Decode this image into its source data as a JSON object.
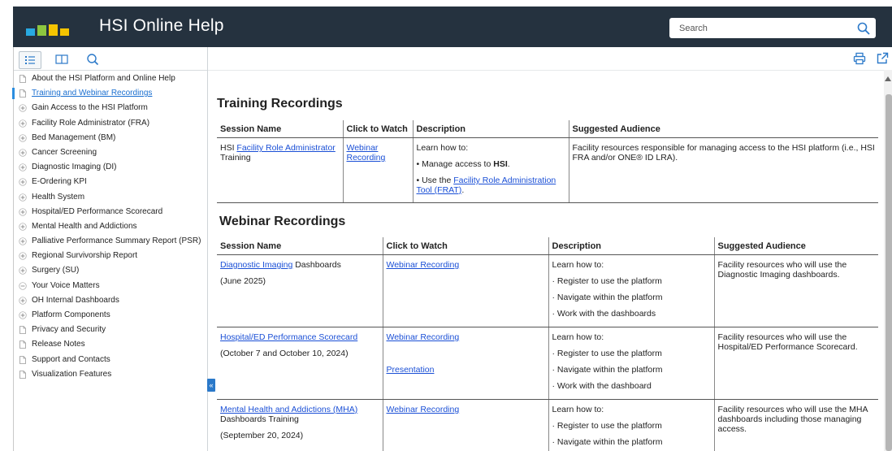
{
  "header": {
    "title": "HSI Online Help",
    "search_placeholder": "Search",
    "logo_colors": [
      "#28a9e1",
      "#8dc63f",
      "#f5c400",
      "#f5c400"
    ]
  },
  "nav_tabs": [
    {
      "name": "contents",
      "icon": "list-icon"
    },
    {
      "name": "index",
      "icon": "book-icon"
    },
    {
      "name": "search",
      "icon": "search-icon"
    }
  ],
  "toc": [
    {
      "label": "About the HSI Platform and Online Help",
      "icon": "page-icon",
      "active": false
    },
    {
      "label": "Training and Webinar Recordings",
      "icon": "page-icon",
      "active": true
    },
    {
      "label": "Gain Access to the HSI Platform",
      "icon": "plus-icon",
      "active": false
    },
    {
      "label": "Facility Role Administrator (FRA)",
      "icon": "plus-icon",
      "active": false
    },
    {
      "label": "Bed Management (BM)",
      "icon": "plus-icon",
      "active": false
    },
    {
      "label": "Cancer Screening",
      "icon": "plus-icon",
      "active": false
    },
    {
      "label": "Diagnostic Imaging (DI)",
      "icon": "plus-icon",
      "active": false
    },
    {
      "label": "E-Ordering KPI",
      "icon": "plus-icon",
      "active": false
    },
    {
      "label": "Health System",
      "icon": "plus-icon",
      "active": false
    },
    {
      "label": "Hospital/ED Performance Scorecard",
      "icon": "plus-icon",
      "active": false
    },
    {
      "label": "Mental Health and Addictions",
      "icon": "plus-icon",
      "active": false
    },
    {
      "label": "Palliative Performance Summary Report (PSR)",
      "icon": "plus-icon",
      "active": false
    },
    {
      "label": "Regional Survivorship Report",
      "icon": "plus-icon",
      "active": false
    },
    {
      "label": "Surgery (SU)",
      "icon": "plus-icon",
      "active": false
    },
    {
      "label": "Your Voice Matters",
      "icon": "minus-icon",
      "active": false
    },
    {
      "label": "OH Internal Dashboards",
      "icon": "plus-icon",
      "active": false
    },
    {
      "label": "Platform Components",
      "icon": "plus-icon",
      "active": false
    },
    {
      "label": "Privacy and Security",
      "icon": "page-icon",
      "active": false
    },
    {
      "label": "Release Notes",
      "icon": "page-icon",
      "active": false
    },
    {
      "label": "Support and Contacts",
      "icon": "page-icon",
      "active": false
    },
    {
      "label": "Visualization Features",
      "icon": "page-icon",
      "active": false
    }
  ],
  "collapse_label": "«",
  "training": {
    "title": "Training Recordings",
    "headers": [
      "Session Name",
      "Click to Watch",
      "Description",
      "Suggested Audience"
    ],
    "row": {
      "name_prefix": "HSI ",
      "name_link": "Facility Role Administrator",
      "name_suffix": " Training",
      "watch_link": "Webinar Recording",
      "desc_intro": "Learn how to:",
      "desc_b1_prefix": "• Manage access to ",
      "desc_b1_bold": "HSI",
      "desc_b1_suffix": ".",
      "desc_b2_prefix": "• Use the ",
      "desc_b2_link": "Facility Role Administration Tool (FRAT)",
      "desc_b2_suffix": ".",
      "audience": "Facility resources responsible for managing access to the HSI platform (i.e., HSI FRA and/or ONE® ID LRA)."
    }
  },
  "webinar": {
    "title": "Webinar Recordings",
    "headers": [
      "Session Name",
      "Click to Watch",
      "Description",
      "Suggested Audience"
    ],
    "rows": [
      {
        "name_link": "Diagnostic Imaging",
        "name_suffix": " Dashboards",
        "date": "(June 2025)",
        "watch_link": "Webinar Recording",
        "watch_link2": "",
        "desc_intro": "Learn how to:",
        "bullets": [
          "· Register to use the platform",
          "· Navigate within the platform",
          "· Work with the dashboards"
        ],
        "audience": "Facility resources who will use the Diagnostic Imaging dashboards."
      },
      {
        "name_link": "Hospital/ED Performance Scorecard",
        "name_suffix": "",
        "date": "(October 7 and October 10, 2024)",
        "watch_link": "Webinar Recording",
        "watch_link2": "Presentation",
        "desc_intro": "Learn how to:",
        "bullets": [
          "· Register to use the platform",
          "· Navigate within the platform",
          "· Work with the dashboard"
        ],
        "audience": "Facility resources who will use the Hospital/ED Performance Scorecard."
      },
      {
        "name_link": "Mental Health and Addictions (MHA)",
        "name_suffix": " Dashboards Training",
        "date": "(September 20, 2024)",
        "watch_link": "Webinar Recording",
        "watch_link2": "",
        "desc_intro": "Learn how to:",
        "bullets": [
          "· Register to use the platform",
          "· Navigate within the platform"
        ],
        "audience": "Facility resources who will use the MHA dashboards including those managing access."
      }
    ]
  },
  "toolbar": {
    "print_icon": "print-icon",
    "open_icon": "open-new-window-icon"
  }
}
